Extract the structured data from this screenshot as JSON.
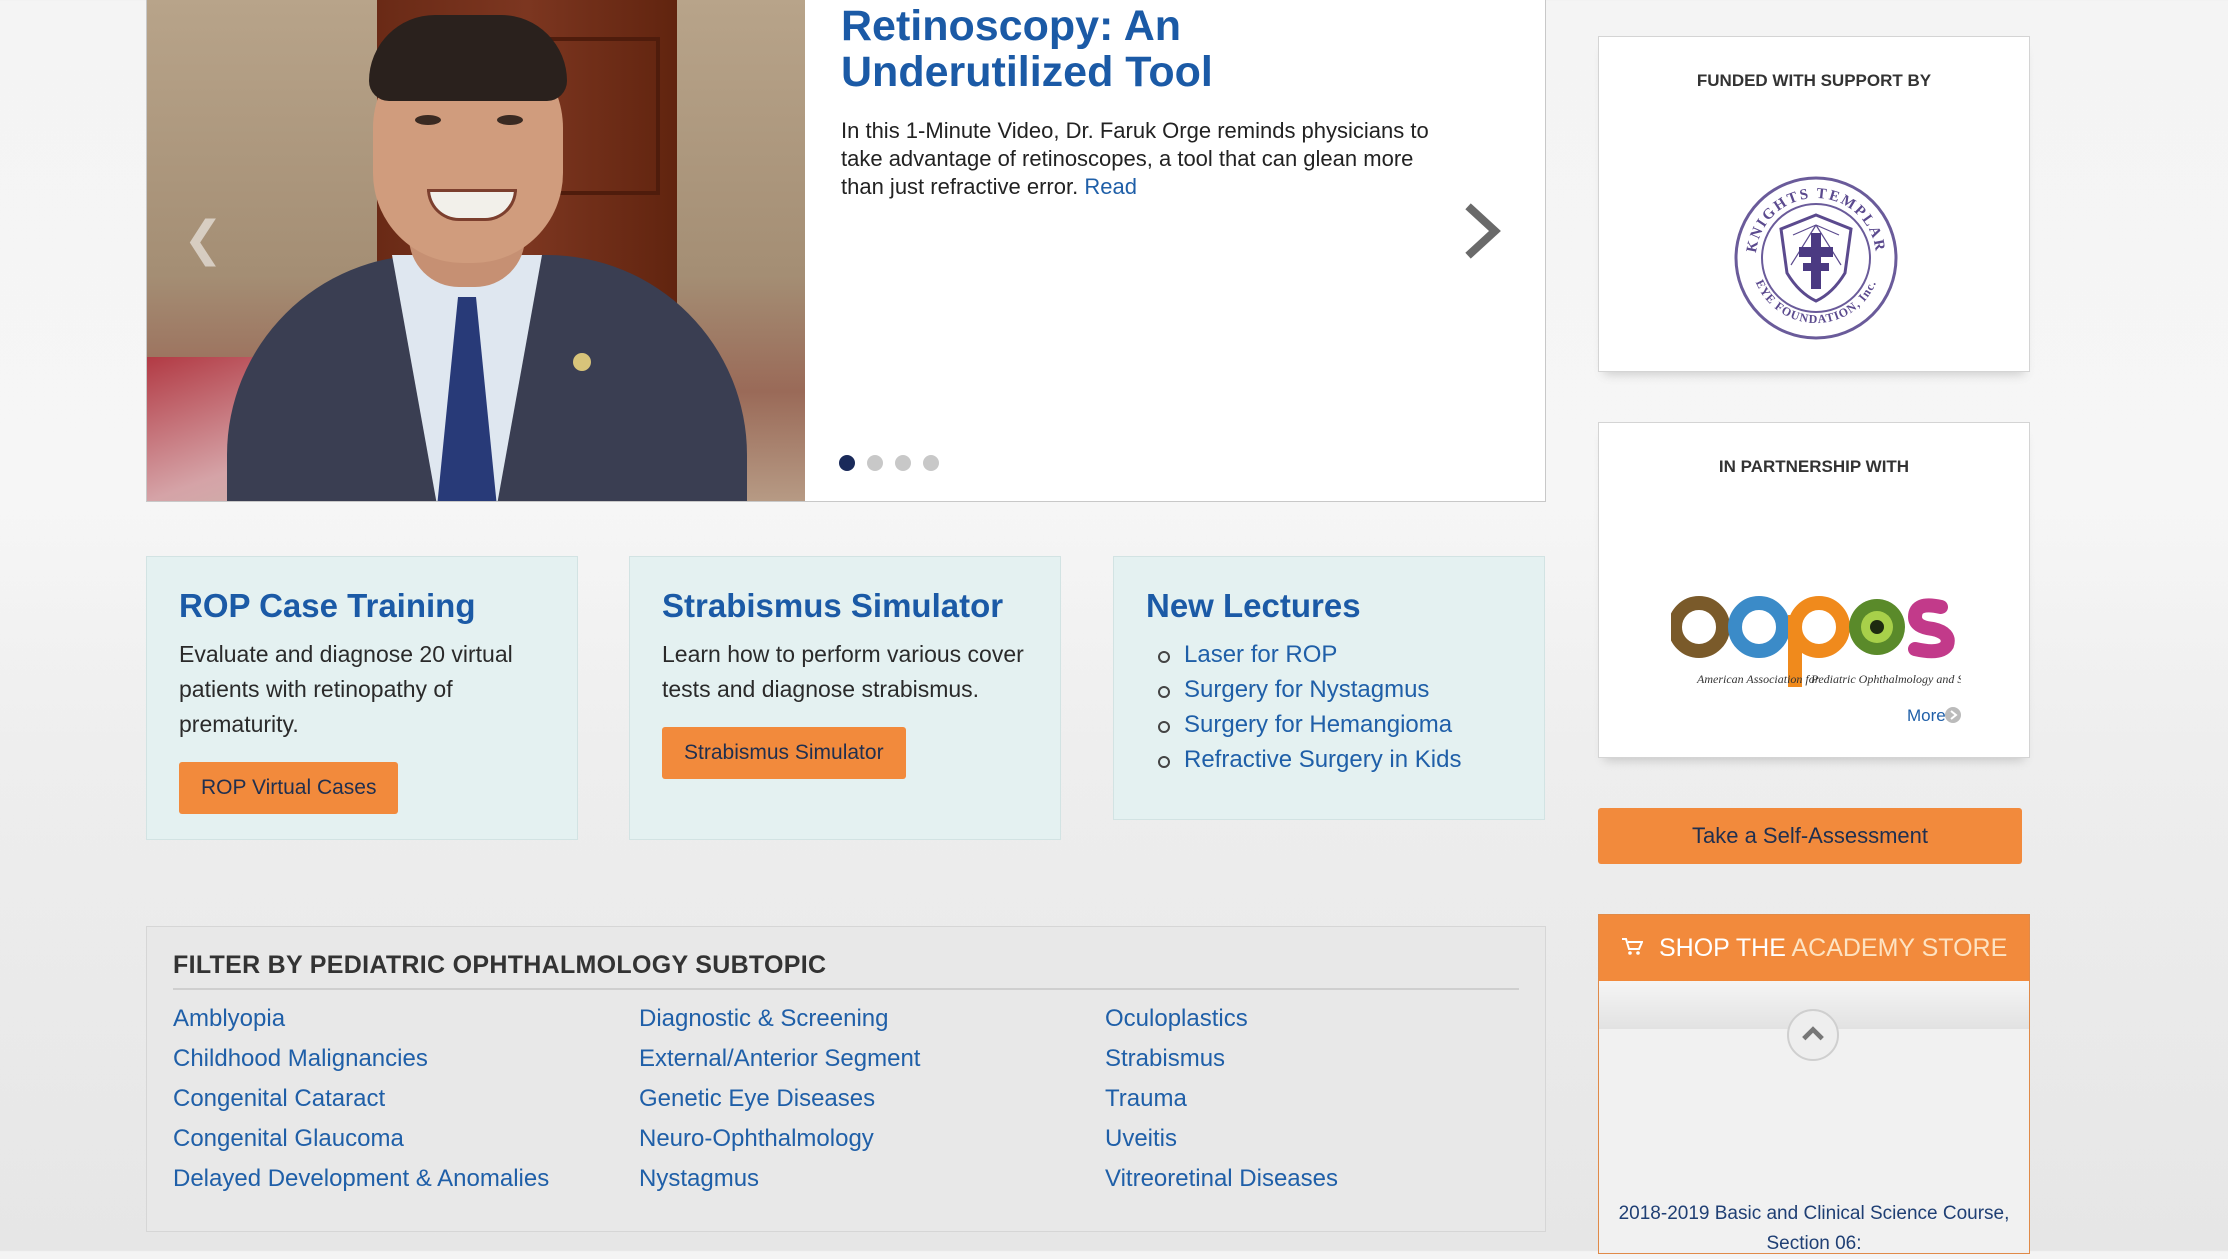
{
  "hero": {
    "title": "Retinoscopy: An Underutilized Tool",
    "description": "In this 1-Minute Video, Dr. Faruk Orge reminds physicians to take advantage of retinoscopes, a tool that can glean more than just refractive error.",
    "read_link": "Read",
    "dots_total": 4,
    "active_dot": 1
  },
  "features": [
    {
      "title": "ROP Case Training",
      "text": "Evaluate and diagnose 20 virtual patients with retinopathy of prematurity.",
      "button": "ROP Virtual Cases"
    },
    {
      "title": "Strabismus Simulator",
      "text": "Learn how to perform various cover tests and diagnose strabismus.",
      "button": "Strabismus Simulator"
    },
    {
      "title": "New Lectures",
      "items": [
        "Laser for ROP",
        "Surgery for Nystagmus",
        "Surgery for Hemangioma",
        "Refractive Surgery in Kids"
      ]
    }
  ],
  "filter": {
    "title": "FILTER BY PEDIATRIC OPHTHALMOLOGY SUBTOPIC",
    "columns": [
      [
        "Amblyopia",
        "Childhood Malignancies",
        "Congenital Cataract",
        "Congenital Glaucoma",
        "Delayed Development & Anomalies"
      ],
      [
        "Diagnostic & Screening",
        "External/Anterior Segment",
        "Genetic Eye Diseases",
        "Neuro-Ophthalmology",
        "Nystagmus"
      ],
      [
        "Oculoplastics",
        "Strabismus",
        "Trauma",
        "Uveitis",
        "Vitreoretinal Diseases"
      ]
    ]
  },
  "sidebar": {
    "funded_caption": "FUNDED WITH SUPPORT BY",
    "funded_logo_text_top": "KNIGHTS TEMPLAR",
    "funded_logo_text_bottom": "EYE FOUNDATION, Inc.",
    "partner_caption": "IN PARTNERSHIP WITH",
    "partner_logo": "aapos",
    "partner_sub_left": "American Association for",
    "partner_sub_right": "Pediatric Ophthalmology and Strabismus",
    "partner_more": "More",
    "assessment_button": "Take a Self-Assessment",
    "store_prefix": "SHOP THE ",
    "store_highlight": "ACADEMY STORE",
    "store_item": "2018-2019 Basic and Clinical Science Course, Section 06:"
  },
  "colors": {
    "link": "#1f5fa8",
    "title": "#1b5aa6",
    "orange": "#f28a3c",
    "feature_bg": "#e4f1f1"
  },
  "icons": [
    "chevron-left-icon",
    "chevron-right-icon",
    "cart-icon",
    "chevron-up-icon",
    "circle-arrow-icon"
  ]
}
